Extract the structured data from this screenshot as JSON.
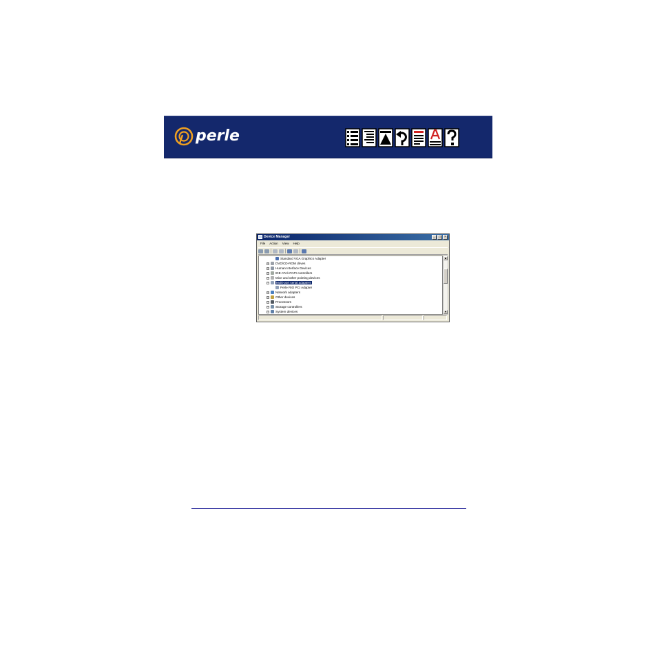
{
  "banner": {
    "logo_text": "perle",
    "nav_icons": [
      "contents-icon",
      "index-icon",
      "top-icon",
      "back-icon",
      "page-icon",
      "glossary-icon",
      "help-icon"
    ],
    "colors": {
      "background": "#14286c",
      "logo_accent": "#f0a020"
    }
  },
  "window": {
    "title": "Device Manager",
    "title_buttons": [
      "_",
      "□",
      "×"
    ],
    "menu": [
      "File",
      "Action",
      "View",
      "Help"
    ],
    "tree": [
      {
        "label": "Standard VGA Graphics Adapter",
        "level": 2,
        "expander": ""
      },
      {
        "label": "DVD/CD-ROM drives",
        "level": 1,
        "expander": "+"
      },
      {
        "label": "Human Interface Devices",
        "level": 1,
        "expander": "+"
      },
      {
        "label": "IDE ATA/ATAPI controllers",
        "level": 1,
        "expander": "+"
      },
      {
        "label": "Mice and other pointing devices",
        "level": 1,
        "expander": "+"
      },
      {
        "label": "Multi-port serial adapters",
        "level": 1,
        "expander": "−",
        "selected": true
      },
      {
        "label": "Perle RIO PCI Adapter",
        "level": 2,
        "expander": ""
      },
      {
        "label": "Network adapters",
        "level": 1,
        "expander": "+"
      },
      {
        "label": "Other devices",
        "level": 1,
        "expander": "+"
      },
      {
        "label": "Processors",
        "level": 1,
        "expander": "+"
      },
      {
        "label": "Storage controllers",
        "level": 1,
        "expander": "+"
      },
      {
        "label": "System devices",
        "level": 1,
        "expander": "−"
      }
    ]
  }
}
